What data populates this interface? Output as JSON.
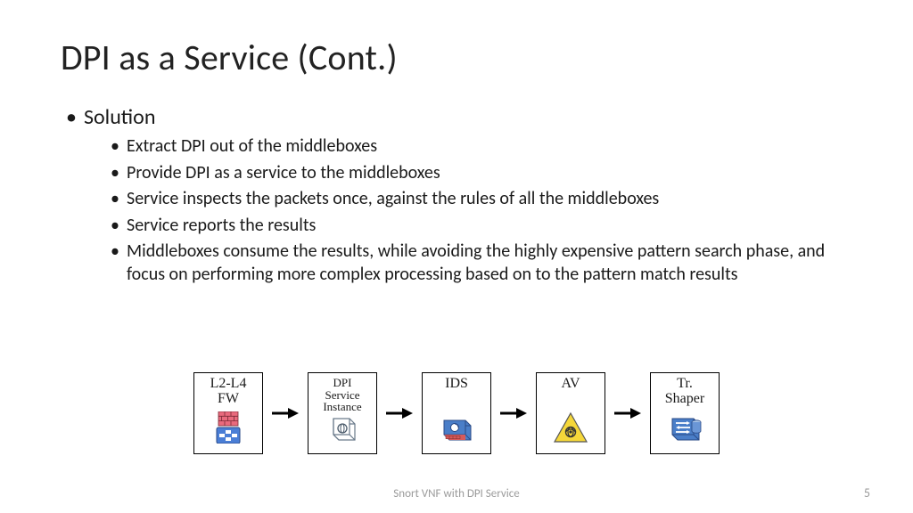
{
  "title": "DPI as a Service (Cont.)",
  "bullets": {
    "l1": "Solution",
    "l2": [
      "Extract DPI out of the middleboxes",
      "Provide DPI as a service to the middleboxes",
      "Service inspects the packets once, against the rules of all the middleboxes",
      "Service reports the results",
      "Middleboxes consume the results, while avoiding the highly expensive pattern search phase, and focus on performing more complex processing based on to the pattern match results"
    ]
  },
  "diagram": {
    "nodes": [
      {
        "label": "L2-L4\nFW",
        "icon": "firewall"
      },
      {
        "label": "DPI\nService\nInstance",
        "icon": "dpi"
      },
      {
        "label": "IDS",
        "icon": "ids"
      },
      {
        "label": "AV",
        "icon": "av"
      },
      {
        "label": "Tr.\nShaper",
        "icon": "shaper"
      }
    ]
  },
  "footer": "Snort VNF with DPI Service",
  "page": "5"
}
